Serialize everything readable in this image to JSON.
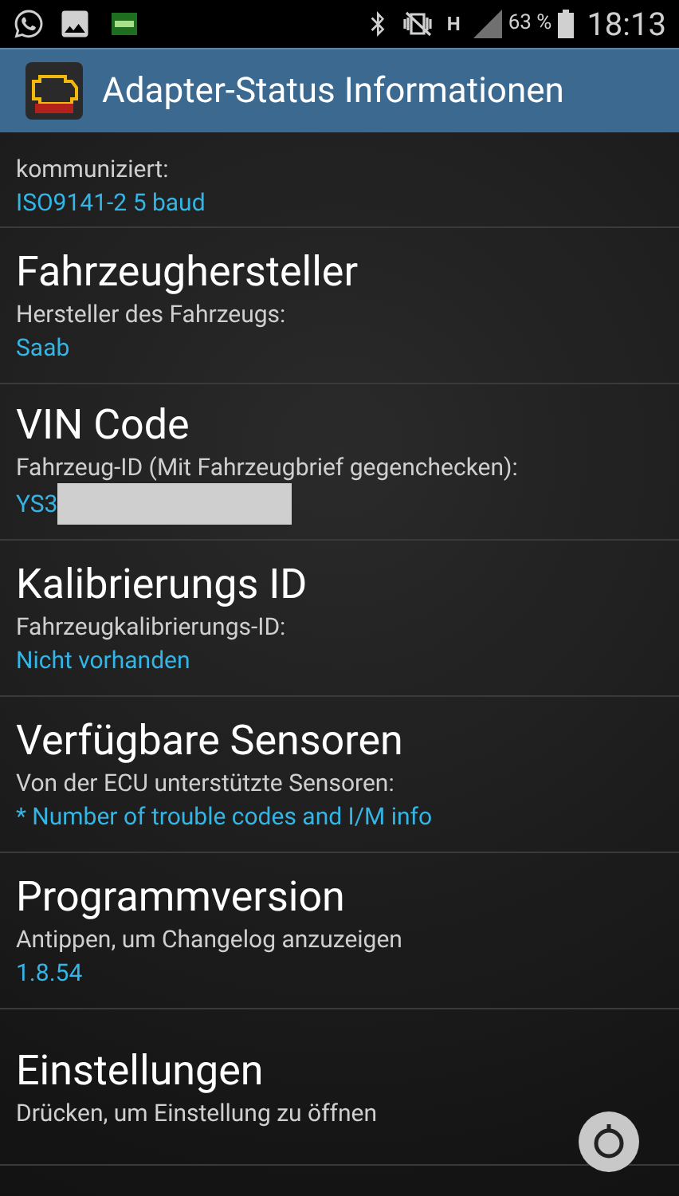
{
  "status_bar": {
    "network": "H",
    "battery": "63 %",
    "time": "18:13"
  },
  "app_bar": {
    "title": "Adapter-Status Informationen"
  },
  "items": [
    {
      "subtitle": "kommuniziert:",
      "value": "ISO9141-2 5 baud",
      "redacted": false
    },
    {
      "title": "Fahrzeughersteller",
      "subtitle": "Hersteller des Fahrzeugs:",
      "value": "Saab",
      "redacted": false
    },
    {
      "title": "VIN Code",
      "subtitle": "Fahrzeug-ID (Mit Fahrzeugbrief gegenchecken):",
      "value": "YS3",
      "redacted": true
    },
    {
      "title": "Kalibrierungs ID",
      "subtitle": "Fahrzeugkalibrierungs-ID:",
      "value": "Nicht vorhanden",
      "redacted": false
    },
    {
      "title": "Verfügbare Sensoren",
      "subtitle": "Von der ECU unterstützte Sensoren:",
      "value": "* Number of trouble codes and I/M info",
      "redacted": false
    },
    {
      "title": "Programmversion",
      "subtitle": "Antippen, um Changelog anzuzeigen",
      "value": "1.8.54",
      "redacted": false
    },
    {
      "title": "Einstellungen",
      "subtitle": "Drücken, um Einstellung zu öffnen"
    }
  ]
}
